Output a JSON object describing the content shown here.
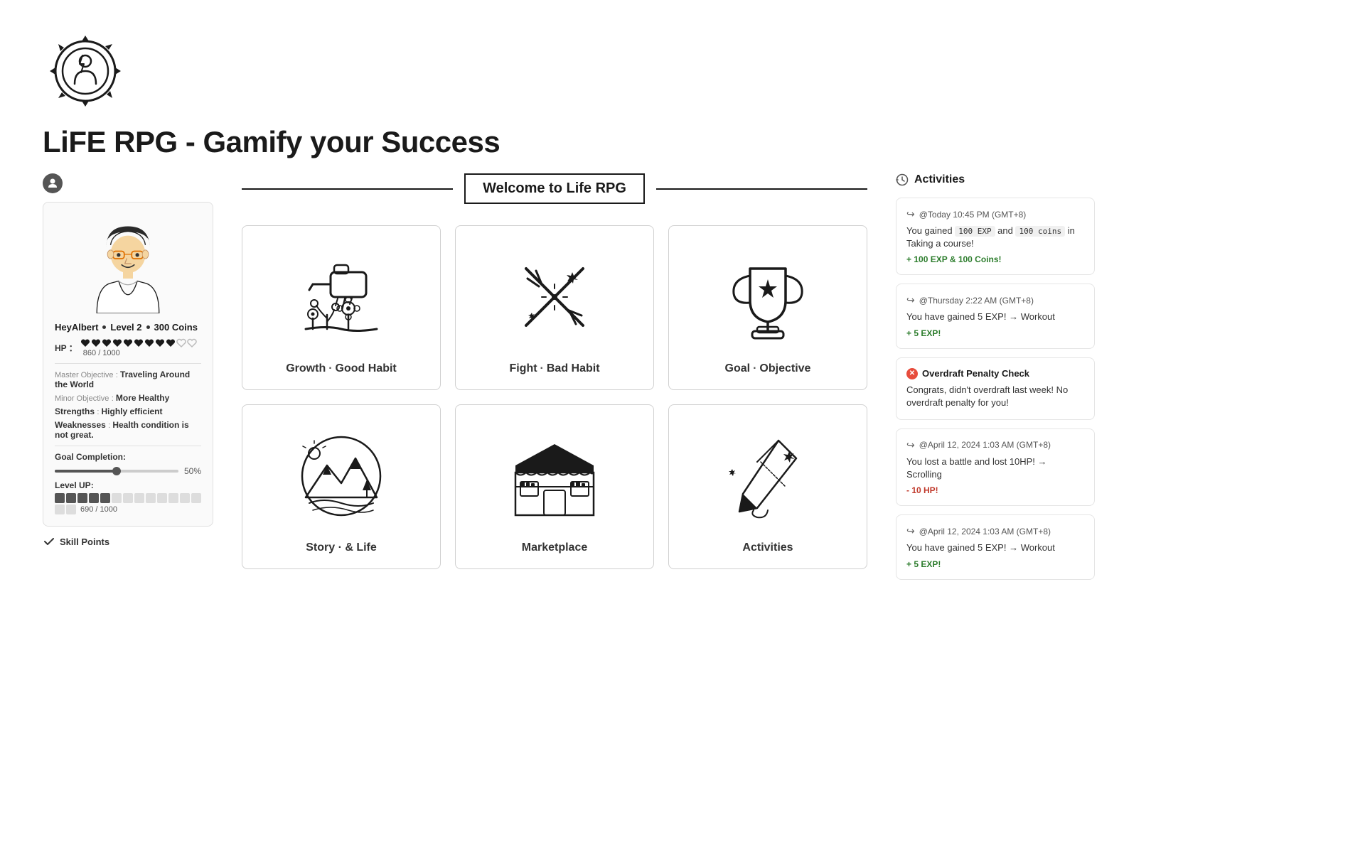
{
  "app": {
    "title": "LiFE RPG - Gamify your Success"
  },
  "character": {
    "name": "HeyAlbert",
    "level": "Level 2",
    "coins": "300 Coins",
    "hp_current": 860,
    "hp_max": 1000,
    "hp_label": "HP ：",
    "hearts_filled": 9,
    "hearts_empty": 2,
    "master_objective_label": "Master Objective",
    "master_objective_value": "Traveling Around the World",
    "minor_objective_label": "Minor Objective",
    "minor_objective_value": "More Healthy",
    "strengths_label": "Strengths",
    "strengths_value": "Highly efficient",
    "weaknesses_label": "Weaknesses",
    "weaknesses_value": "Health condition is not great.",
    "goal_completion_label": "Goal Completion:",
    "goal_pct": "50%",
    "goal_pct_num": 50,
    "level_up_label": "Level UP:",
    "level_current": 690,
    "level_max": 1000,
    "level_blocks_filled": 5,
    "level_blocks_total": 15,
    "skill_points_label": "Skill Points"
  },
  "welcome": {
    "text": "Welcome to Life RPG"
  },
  "grid": {
    "cards": [
      {
        "id": "growth",
        "label_pre": "Growth",
        "label_post": "Good Habit",
        "icon": "growth"
      },
      {
        "id": "fight",
        "label_pre": "Fight",
        "label_post": "Bad Habit",
        "icon": "fight"
      },
      {
        "id": "goal",
        "label_pre": "Goal",
        "label_post": "Objective",
        "icon": "goal"
      },
      {
        "id": "story",
        "label_pre": "Story",
        "label_post": "& Life",
        "icon": "story"
      },
      {
        "id": "marketplace",
        "label_pre": "Marketplace",
        "label_post": "",
        "icon": "marketplace"
      },
      {
        "id": "activities",
        "label_pre": "Activities",
        "label_post": "",
        "icon": "activities_pen"
      }
    ]
  },
  "activities": {
    "header": "Activities",
    "items": [
      {
        "type": "gain",
        "timestamp": "@Today 10:45 PM (GMT+8)",
        "desc_pre": "You gained ",
        "badge1": "100 EXP",
        "desc_mid": " and ",
        "badge2": "100 coins",
        "desc_post": " in Taking a course!",
        "reward": "+ 100 EXP & 100 Coins!",
        "reward_type": "positive"
      },
      {
        "type": "gain",
        "timestamp": "@Thursday 2:22 AM (GMT+8)",
        "desc_pre": "You have gained 5 EXP! → Workout",
        "badge1": "",
        "desc_mid": "",
        "badge2": "",
        "desc_post": "",
        "reward": "+ 5 EXP!",
        "reward_type": "positive"
      },
      {
        "type": "penalty",
        "header": "Overdraft Penalty Check",
        "desc": "Congrats, didn't overdraft last week! No overdraft penalty for you!",
        "reward": "",
        "reward_type": ""
      },
      {
        "type": "gain",
        "timestamp": "@April 12, 2024 1:03 AM (GMT+8)",
        "desc_pre": "You lost a battle and lost 10HP! → Scrolling",
        "badge1": "",
        "desc_mid": "",
        "badge2": "",
        "desc_post": "",
        "reward": "- 10 HP!",
        "reward_type": "negative"
      },
      {
        "type": "gain",
        "timestamp": "@April 12, 2024 1:03 AM (GMT+8)",
        "desc_pre": "You have gained 5 EXP! → Workout",
        "badge1": "",
        "desc_mid": "",
        "badge2": "",
        "desc_post": "",
        "reward": "+ 5 EXP!",
        "reward_type": "positive"
      }
    ]
  }
}
